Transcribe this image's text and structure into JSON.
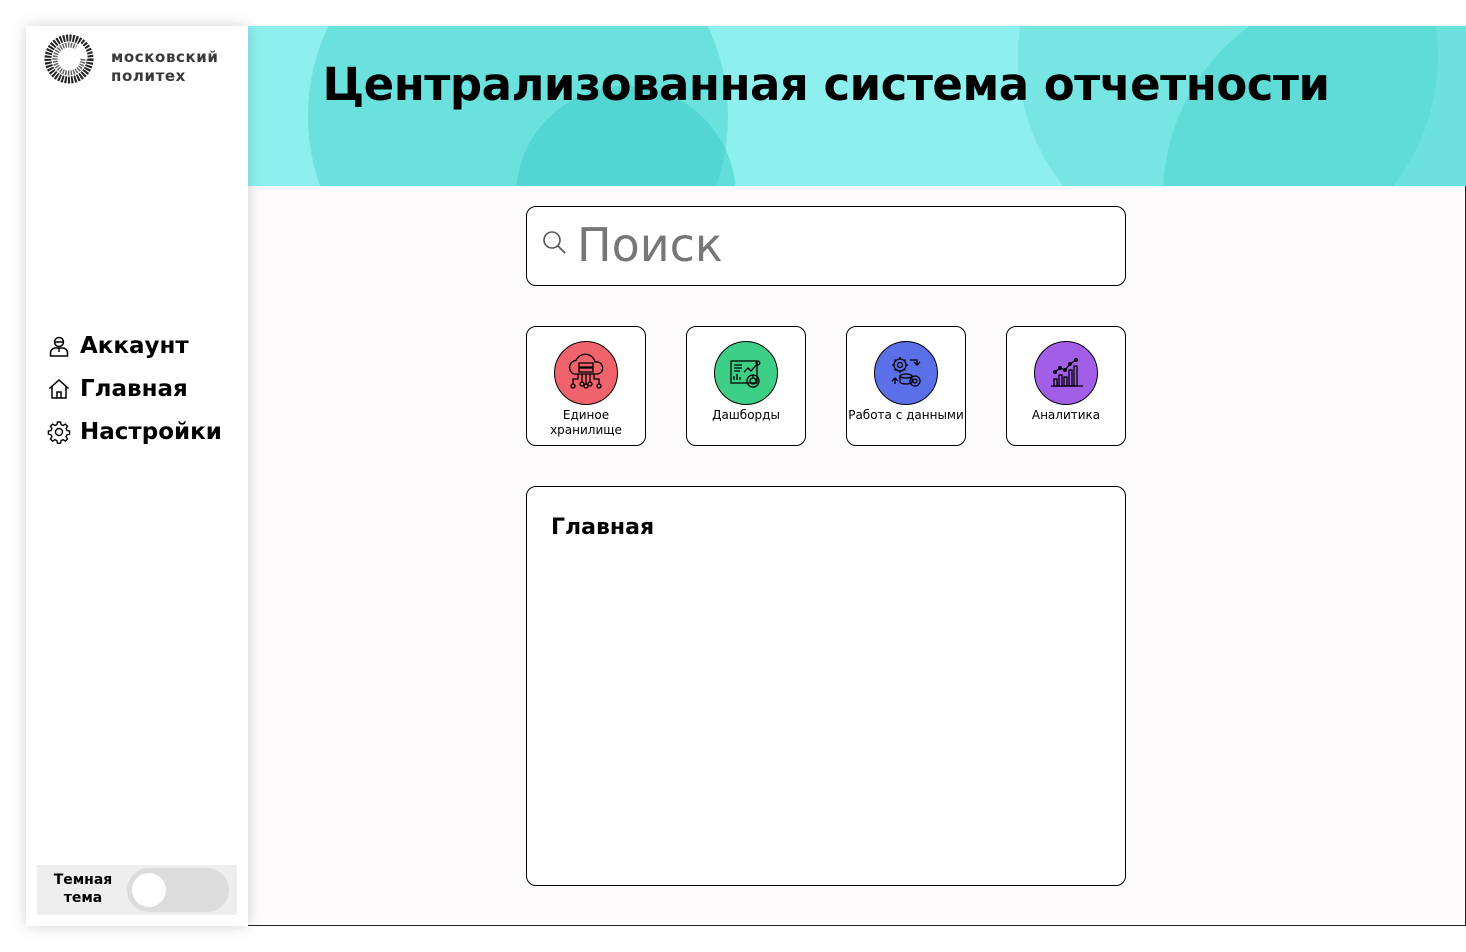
{
  "brand": {
    "line1": "московский",
    "line2": "политех"
  },
  "header": {
    "title": "Централизованная система отчетности"
  },
  "sidebar": {
    "items": [
      {
        "label": "Аккаунт",
        "icon": "user-icon"
      },
      {
        "label": "Главная",
        "icon": "home-icon"
      },
      {
        "label": "Настройки",
        "icon": "gear-icon"
      }
    ],
    "theme_toggle": {
      "label": "Темная тема",
      "enabled": false
    }
  },
  "search": {
    "placeholder": "Поиск",
    "value": ""
  },
  "tiles": [
    {
      "label": "Единое хранилище",
      "icon": "cloud-storage-icon",
      "color": "#f0636c"
    },
    {
      "label": "Дашборды",
      "icon": "dashboard-icon",
      "color": "#3ecf86"
    },
    {
      "label": "Работа с данными",
      "icon": "data-processing-icon",
      "color": "#5b6fe8"
    },
    {
      "label": "Аналитика",
      "icon": "analytics-icon",
      "color": "#a35ee8"
    }
  ],
  "content": {
    "title": "Главная"
  },
  "colors": {
    "banner": "#8ef0ee",
    "sidebar_bg": "#ffffff",
    "toggle_track": "#dcdcdc"
  }
}
